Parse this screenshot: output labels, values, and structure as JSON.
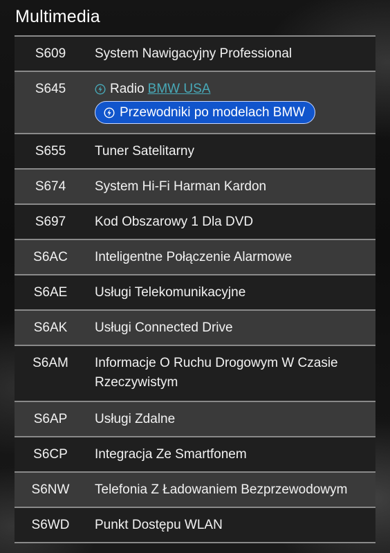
{
  "section": {
    "title": "Multimedia"
  },
  "options": [
    {
      "code": "S609",
      "label": "System Nawigacyjny Professional"
    },
    {
      "code": "S645",
      "label": "Radio",
      "link_label": "BMW USA",
      "button_label": "Przewodniki po modelach BMW",
      "icon": "bolt-icon"
    },
    {
      "code": "S655",
      "label": "Tuner Satelitarny"
    },
    {
      "code": "S674",
      "label": "System Hi-Fi Harman Kardon"
    },
    {
      "code": "S697",
      "label": "Kod Obszarowy 1 Dla DVD"
    },
    {
      "code": "S6AC",
      "label": "Inteligentne Połączenie Alarmowe"
    },
    {
      "code": "S6AE",
      "label": "Usługi Telekomunikacyjne"
    },
    {
      "code": "S6AK",
      "label": "Usługi Connected Drive"
    },
    {
      "code": "S6AM",
      "label": "Informacje O Ruchu Drogowym W Czasie Rzeczywistym"
    },
    {
      "code": "S6AP",
      "label": "Usługi Zdalne"
    },
    {
      "code": "S6CP",
      "label": "Integracja Ze Smartfonem"
    },
    {
      "code": "S6NW",
      "label": "Telefonia Z Ładowaniem Bezprzewodowym"
    },
    {
      "code": "S6WD",
      "label": "Punkt Dostępu WLAN"
    }
  ],
  "colors": {
    "row_dark": "#1f1f1f",
    "row_light": "#3a3a3a",
    "divider": "#8a8a8a",
    "link": "#48a9b8",
    "button_bg": "#1155cc"
  }
}
